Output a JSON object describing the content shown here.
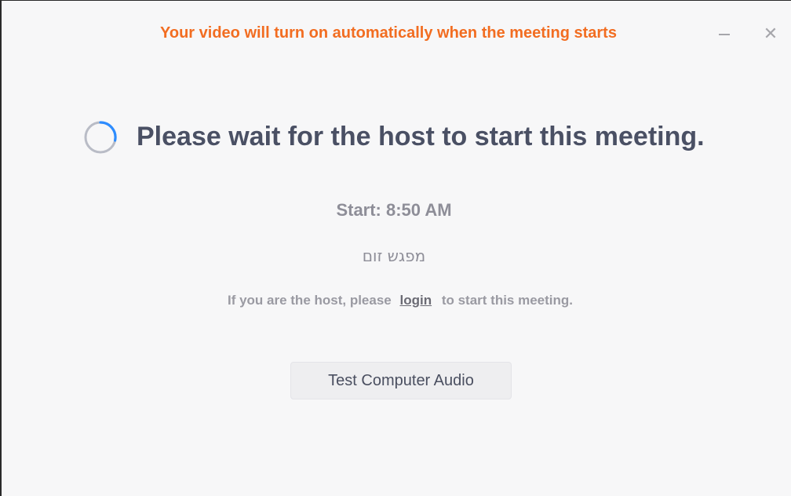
{
  "window": {
    "banner_text": "Your video will turn on automatically when the meeting starts",
    "minimize_icon": "minimize-icon",
    "close_icon": "close-icon",
    "close_glyph": "✕"
  },
  "main": {
    "spinner_icon": "loading-spinner-icon",
    "title": "Please wait for the host to start this meeting.",
    "start_time": "Start: 8:50 AM",
    "meeting_name": "מפגש זום",
    "host_note_prefix": "If you are the host, please",
    "login_link": "login",
    "host_note_suffix": "to start this meeting.",
    "test_audio_button": "Test Computer Audio"
  },
  "colors": {
    "banner": "#f26d21",
    "title": "#4a5064",
    "muted": "#8e8e98",
    "spinner_accent": "#2d8cff",
    "background": "#f7f7f8"
  }
}
